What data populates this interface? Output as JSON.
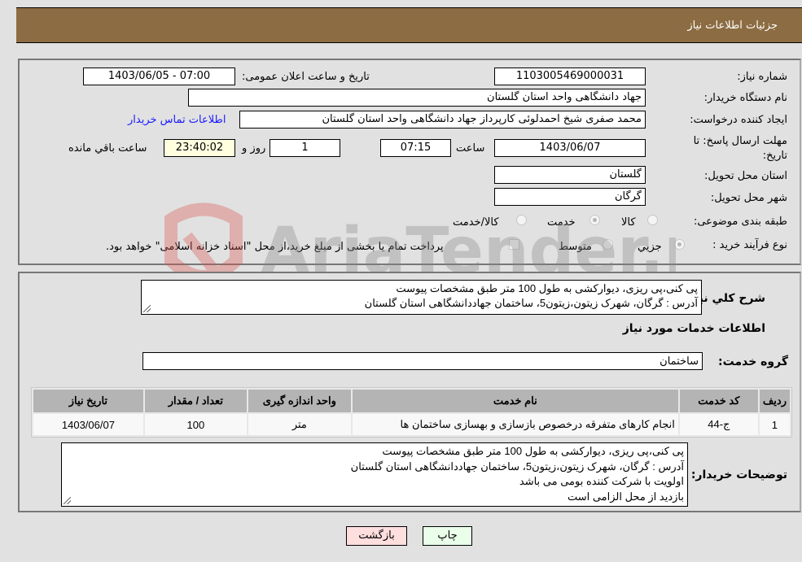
{
  "header": {
    "title": "جزئیات اطلاعات نیاز"
  },
  "fields": {
    "need_number_label": "شماره نیاز:",
    "need_number": "1103005469000031",
    "announce_label": "تاریخ و ساعت اعلان عمومی:",
    "announce_value": "1403/06/05 - 07:00",
    "buyer_org_label": "نام دستگاه خریدار:",
    "buyer_org": "جهاد دانشگاهی واحد استان گلستان",
    "requester_label": "ایجاد کننده درخواست:",
    "requester": "محمد صفری شیخ احمدلوئی کارپرداز جهاد دانشگاهی واحد استان گلستان",
    "contact_link": "اطلاعات تماس خریدار",
    "deadline_label": "مهلت ارسال پاسخ: تا تاریخ:",
    "deadline_date": "1403/06/07",
    "time_label": "ساعت",
    "deadline_time": "07:15",
    "days_value": "1",
    "days_label": "روز و",
    "remaining_time": "23:40:02",
    "remaining_label": "ساعت باقي مانده",
    "province_label": "استان محل تحویل:",
    "province": "گلستان",
    "city_label": "شهر محل تحویل:",
    "city": "گرگان",
    "category_label": "طبقه بندی موضوعی:",
    "category_options": [
      "کالا",
      "خدمت",
      "کالا/خدمت"
    ],
    "category_selected": "خدمت",
    "process_label": "نوع فرآیند خرید :",
    "process_options": [
      "جزيي",
      "متوسط"
    ],
    "process_selected": "جزيي",
    "treasury_note": "پرداخت تمام یا بخشی از مبلغ خرید،از محل \"اسناد خزانه اسلامی\" خواهد بود."
  },
  "description": {
    "label": "شرح كلي نياز:",
    "lines": [
      "پی کنی،پی ریزی، دیوارکشی به طول 100 متر طبق مشخصات پیوست",
      "آدرس : گرگان، شهرک زیتون،زیتون5، ساختمان جهاددانشگاهی استان گلستان"
    ]
  },
  "services": {
    "section_title": "اطلاعات خدمات مورد نیاز",
    "group_label": "گروه خدمت:",
    "group_value": "ساختمان",
    "columns": [
      "ردیف",
      "کد خدمت",
      "نام خدمت",
      "واحد اندازه گیری",
      "تعداد / مقدار",
      "تاریخ نیاز"
    ],
    "rows": [
      [
        "1",
        "ج-44",
        "انجام کارهای متفرقه درخصوص بازسازی و بهسازی ساختمان ها",
        "متر",
        "100",
        "1403/06/07"
      ]
    ]
  },
  "buyer_notes": {
    "label": "توضیحات خریدار:",
    "lines": [
      "پی کنی،پی ریزی، دیوارکشی به طول 100 متر طبق مشخصات پیوست",
      "آدرس : گرگان، شهرک زیتون،زیتون5، ساختمان جهاددانشگاهی استان گلستان",
      "اولویت با شرکت کننده بومی می باشد",
      "بازدید از محل الزامی است"
    ]
  },
  "buttons": {
    "print": "چاپ",
    "back": "بازگشت"
  },
  "watermark": {
    "text": "AriaTender.neT"
  }
}
